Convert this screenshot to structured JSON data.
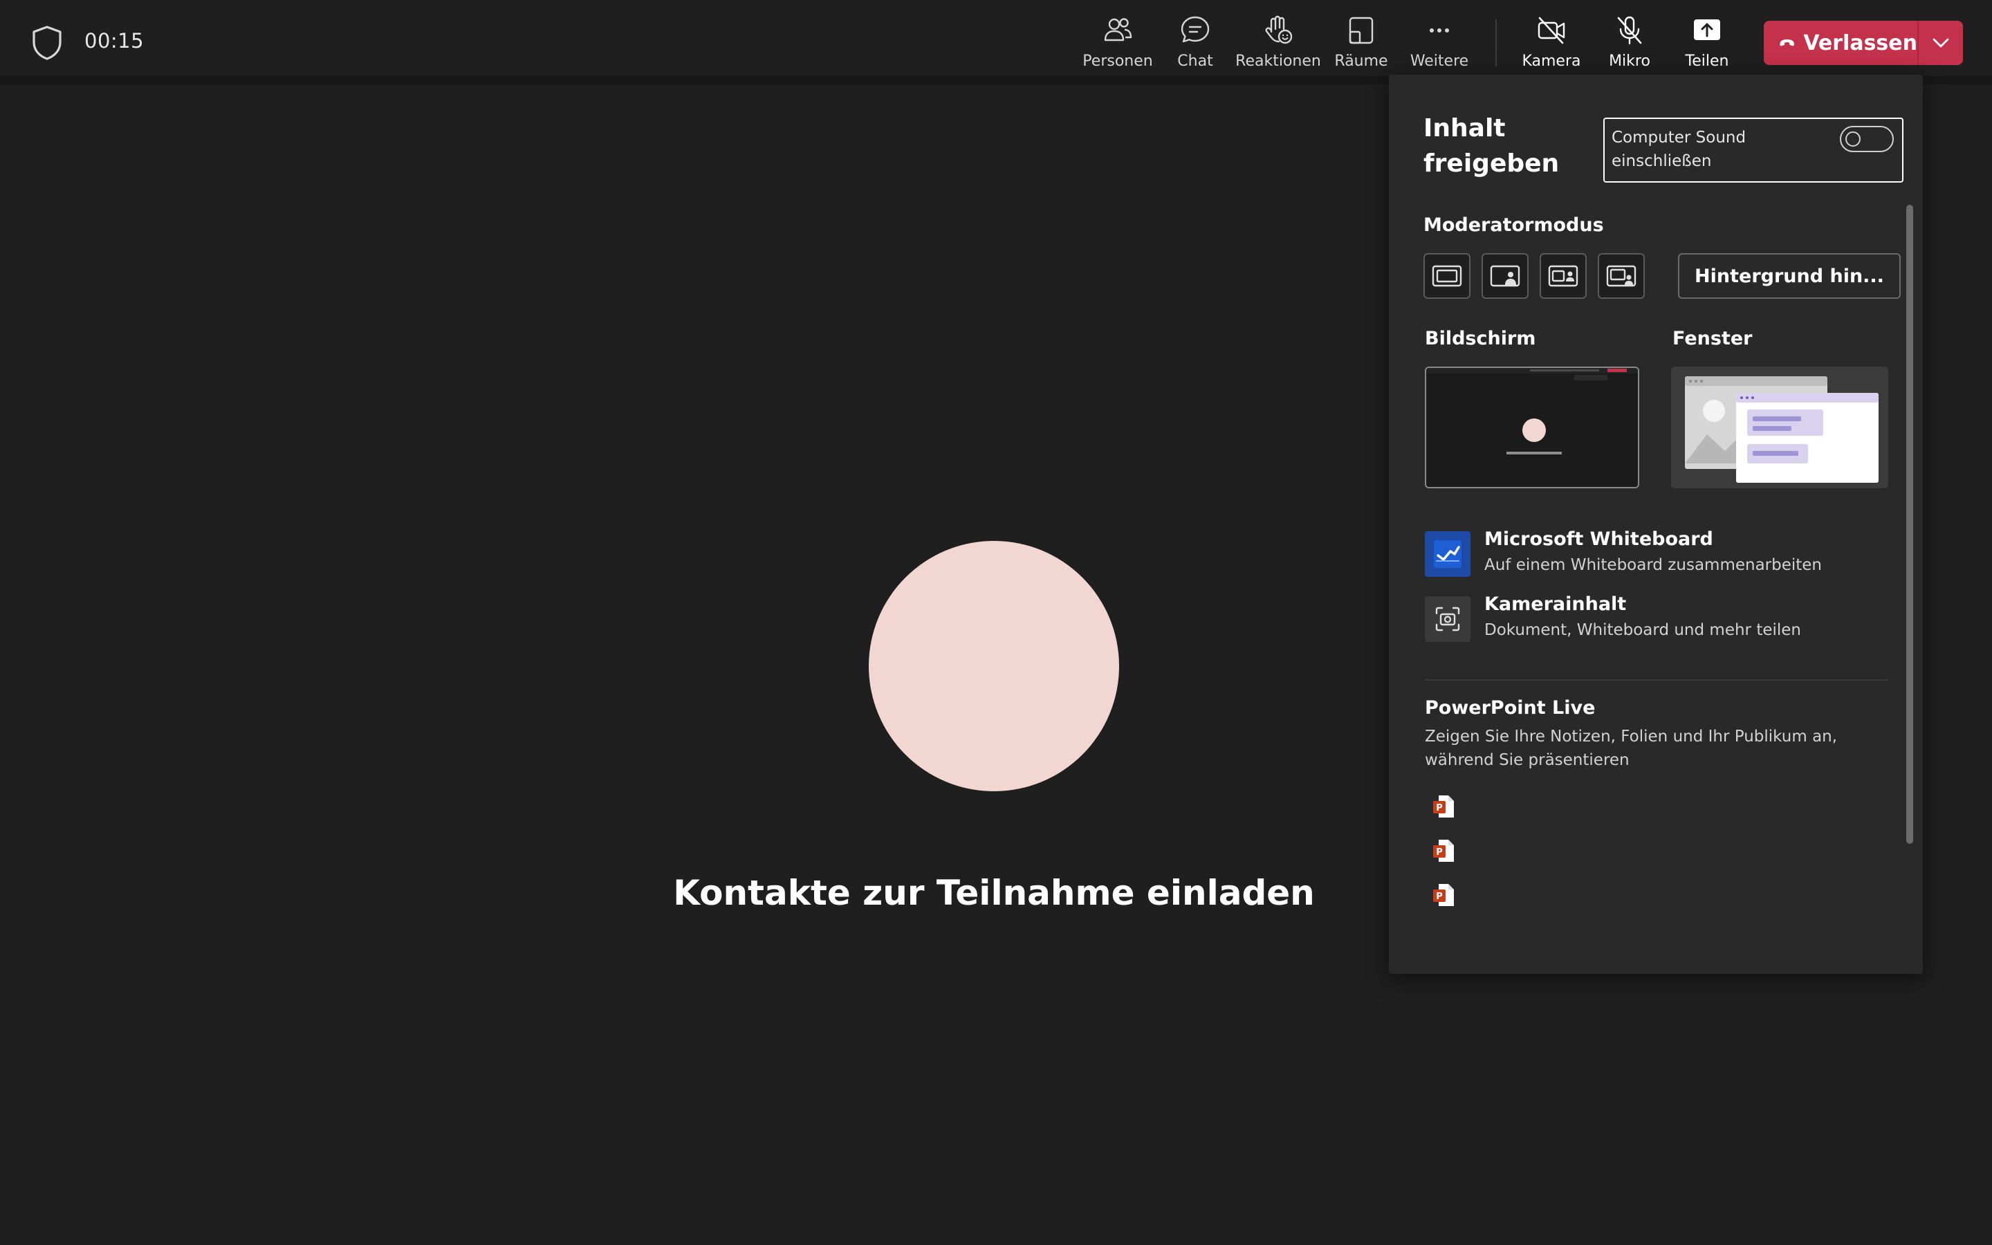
{
  "header": {
    "timer": "00:15",
    "tools": [
      {
        "id": "people",
        "label": "Personen",
        "icon": "people-icon"
      },
      {
        "id": "chat",
        "label": "Chat",
        "icon": "chat-icon"
      },
      {
        "id": "reactions",
        "label": "Reaktionen",
        "icon": "raise-hand-icon"
      },
      {
        "id": "rooms",
        "label": "Räume",
        "icon": "breakout-rooms-icon"
      },
      {
        "id": "more",
        "label": "Weitere",
        "icon": "more-icon"
      },
      {
        "id": "camera",
        "label": "Kamera",
        "icon": "camera-off-icon"
      },
      {
        "id": "mic",
        "label": "Mikro",
        "icon": "mic-off-icon"
      },
      {
        "id": "share",
        "label": "Teilen",
        "icon": "share-icon"
      }
    ],
    "leave_label": "Verlassen",
    "leave_color": "#c4314b"
  },
  "stage": {
    "invite_text": "Kontakte zur Teilnahme einladen",
    "avatar_color": "#f1d6d1"
  },
  "share_panel": {
    "title": "Inhalt freigeben",
    "computer_sound_label": "Computer Sound einschließen",
    "computer_sound_on": false,
    "presenter_mode_label": "Moderatormodus",
    "presenter_modes": [
      "content-only-icon",
      "standout-icon",
      "side-by-side-icon",
      "reporter-icon"
    ],
    "background_button": "Hintergrund hin...",
    "screen_label": "Bildschirm",
    "window_label": "Fenster",
    "apps": [
      {
        "title": "Microsoft Whiteboard",
        "desc": "Auf einem Whiteboard zusammenarbeiten",
        "icon": "whiteboard-icon"
      },
      {
        "title": "Kamerainhalt",
        "desc": "Dokument, Whiteboard und mehr teilen",
        "icon": "camera-content-icon"
      }
    ],
    "powerpoint_title": "PowerPoint Live",
    "powerpoint_desc": "Zeigen Sie Ihre Notizen, Folien und Ihr Publikum an, während Sie präsentieren",
    "powerpoint_files": [
      "powerpoint-file-icon",
      "powerpoint-file-icon",
      "powerpoint-file-icon"
    ]
  }
}
